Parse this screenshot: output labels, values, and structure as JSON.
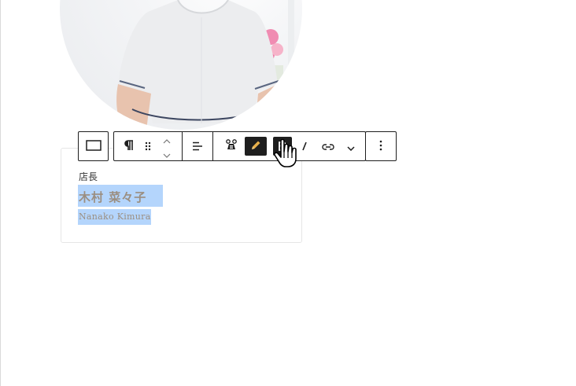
{
  "profile": {
    "role": "店長",
    "name": "木村 菜々子",
    "name_roman": "Nanako Kimura"
  },
  "toolbar": {
    "buttons": [
      {
        "icon": "block-type-icon"
      },
      {
        "icon": "paragraph-icon"
      },
      {
        "icon": "drag-handle-icon"
      },
      {
        "icon": "chevron-up-icon"
      },
      {
        "icon": "chevron-down-icon"
      },
      {
        "icon": "align-left-icon"
      },
      {
        "icon": "toolset-icon"
      },
      {
        "icon": "pencil-icon"
      },
      {
        "icon": "bold-icon"
      },
      {
        "icon": "italic-icon"
      },
      {
        "icon": "link-icon"
      },
      {
        "icon": "more-rich-text-icon"
      },
      {
        "icon": "options-icon"
      }
    ]
  },
  "colors": {
    "selection": "#b4d5fc",
    "name_text": "#9b8e80",
    "toolbar_dark": "#1e1e1e"
  }
}
